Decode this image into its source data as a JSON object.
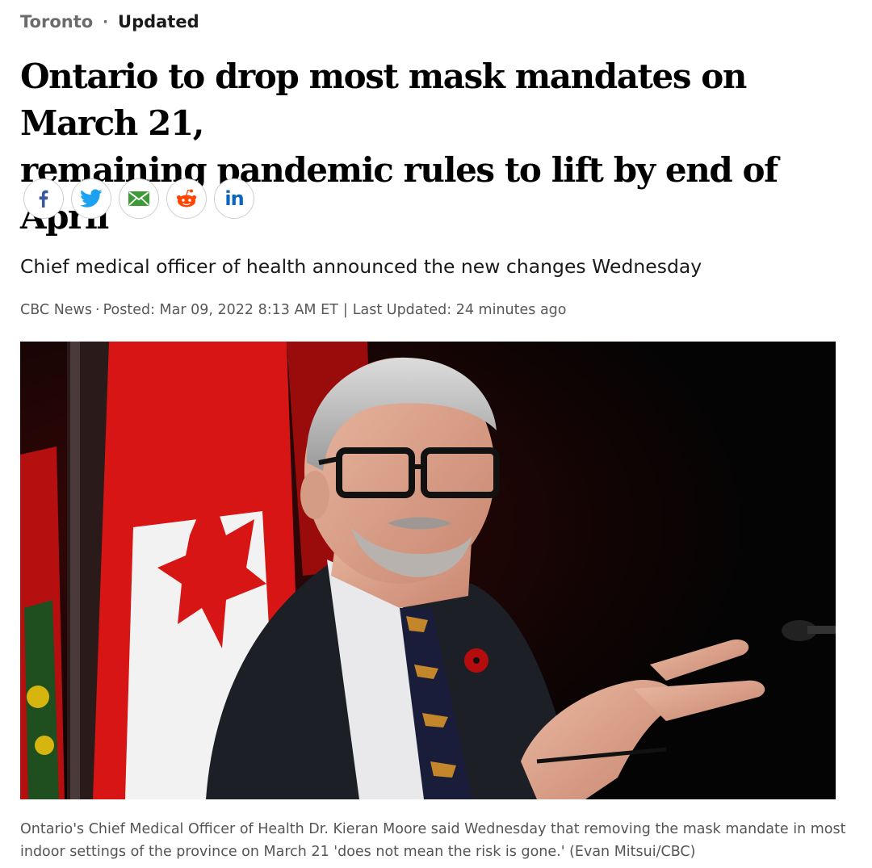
{
  "section": "Toronto",
  "status": "Updated",
  "headline": {
    "line1": "Ontario to drop most mask mandates on March 21,",
    "line2": "remaining pandemic rules to lift by end of April"
  },
  "share": [
    {
      "label": "f",
      "icon": "facebook-icon",
      "color": "#3b5998"
    },
    {
      "label": "",
      "icon": "twitter-icon",
      "color": "#1da1f2"
    },
    {
      "label": "",
      "icon": "email-icon",
      "color": "#3d9b37"
    },
    {
      "label": "",
      "icon": "reddit-icon",
      "color": "#ff4500"
    },
    {
      "label": "in",
      "icon": "linkedin-icon",
      "color": "#0a66c2"
    }
  ],
  "deck": "Chief medical officer of health announced the new changes Wednesday",
  "byline": {
    "source": "CBC News",
    "posted": "Posted: Mar 09, 2022 8:13 AM ET",
    "updated": "Last Updated: 24 minutes ago"
  },
  "caption": "Ontario's Chief Medical Officer of Health Dr. Kieran Moore said Wednesday that removing the mask mandate in most indoor settings of the province on March 21 'does not mean the risk is gone.' (Evan Mitsui/CBC)"
}
